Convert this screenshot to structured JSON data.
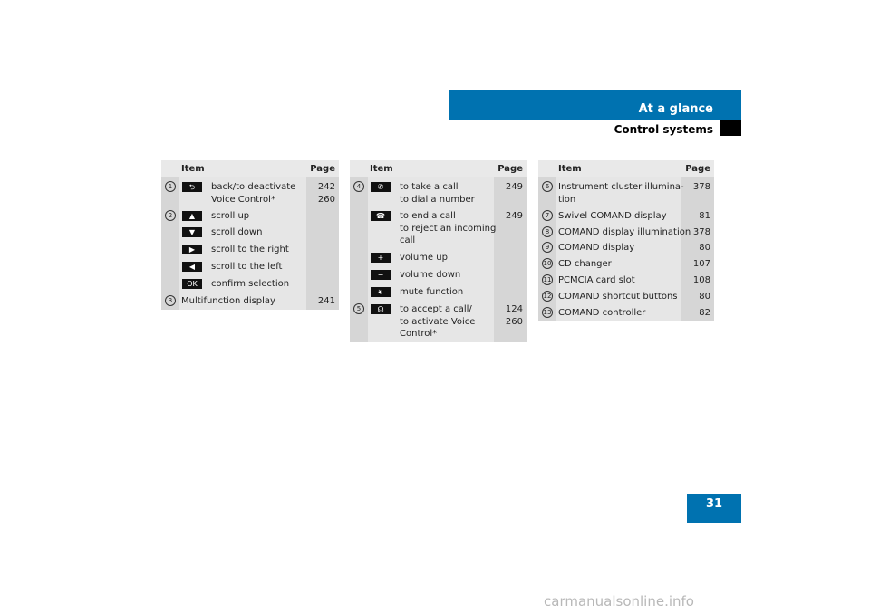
{
  "header": {
    "section": "At a glance",
    "subsection": "Control systems",
    "page_number": "31"
  },
  "watermark": "carmanualsonline.info",
  "tables": [
    {
      "header": {
        "item": "Item",
        "page": "Page"
      },
      "rows": [
        {
          "num": "1",
          "icon": "back-icon",
          "glyph": "⮌",
          "text": "back/to deactivate\nVoice Control*",
          "page": "242\n260"
        },
        {
          "num": "2",
          "icon": "arrow-up-icon",
          "glyph": "▲",
          "text": "scroll up",
          "page": ""
        },
        {
          "num": "",
          "icon": "arrow-down-icon",
          "glyph": "▼",
          "text": "scroll down",
          "page": ""
        },
        {
          "num": "",
          "icon": "arrow-right-icon",
          "glyph": "▶",
          "text": "scroll to the right",
          "page": ""
        },
        {
          "num": "",
          "icon": "arrow-left-icon",
          "glyph": "◀",
          "text": "scroll to the left",
          "page": ""
        },
        {
          "num": "",
          "icon": "ok-icon",
          "glyph": "OK",
          "text": "confirm selection",
          "page": ""
        },
        {
          "num": "3",
          "icon": "",
          "glyph": "",
          "text": "Multifunction display",
          "page": "241"
        }
      ]
    },
    {
      "header": {
        "item": "Item",
        "page": "Page"
      },
      "rows": [
        {
          "num": "4",
          "icon": "phone-pickup-icon",
          "glyph": "✆",
          "text": "to take a call\nto dial a number",
          "page": "249"
        },
        {
          "num": "",
          "icon": "phone-hangup-icon",
          "glyph": "☎",
          "text": "to end a call\nto reject an incoming\ncall",
          "page": "249"
        },
        {
          "num": "",
          "icon": "plus-icon",
          "glyph": "+",
          "text": "volume up",
          "page": ""
        },
        {
          "num": "",
          "icon": "minus-icon",
          "glyph": "−",
          "text": "volume down",
          "page": ""
        },
        {
          "num": "",
          "icon": "mute-icon",
          "glyph": "🔇︎",
          "text": "mute function",
          "page": ""
        },
        {
          "num": "5",
          "icon": "voice-control-icon",
          "glyph": "☊",
          "text": "to accept a call/\nto activate Voice\nControl*",
          "page": "124\n260"
        }
      ]
    },
    {
      "header": {
        "item": "Item",
        "page": "Page"
      },
      "rows": [
        {
          "num": "6",
          "icon": "",
          "glyph": "",
          "text": "Instrument cluster illumina-\ntion",
          "page": "378"
        },
        {
          "num": "7",
          "icon": "",
          "glyph": "",
          "text": "Swivel COMAND display",
          "page": "81"
        },
        {
          "num": "8",
          "icon": "",
          "glyph": "",
          "text": "COMAND display illumination",
          "page": "378"
        },
        {
          "num": "9",
          "icon": "",
          "glyph": "",
          "text": "COMAND display",
          "page": "80"
        },
        {
          "num": "10",
          "icon": "",
          "glyph": "",
          "text": "CD changer",
          "page": "107"
        },
        {
          "num": "11",
          "icon": "",
          "glyph": "",
          "text": "PCMCIA card slot",
          "page": "108"
        },
        {
          "num": "12",
          "icon": "",
          "glyph": "",
          "text": "COMAND shortcut buttons",
          "page": "80"
        },
        {
          "num": "13",
          "icon": "",
          "glyph": "",
          "text": "COMAND controller",
          "page": "82"
        }
      ]
    }
  ]
}
